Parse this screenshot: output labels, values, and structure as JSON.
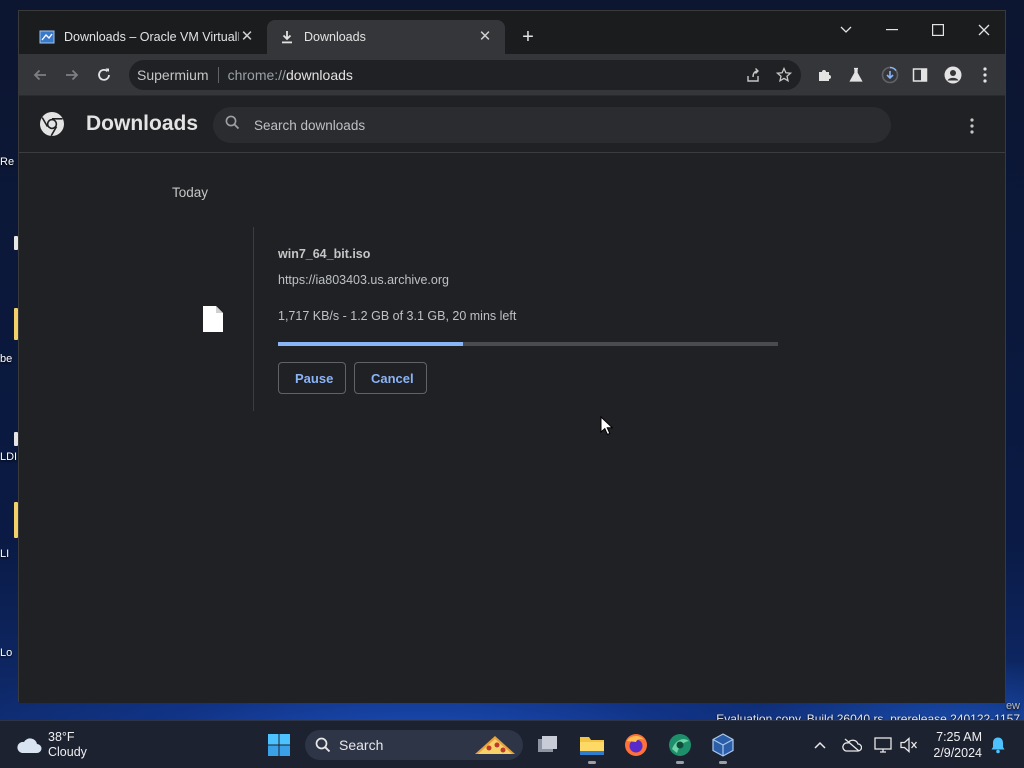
{
  "desktop": {
    "icons": [
      {
        "label": "Re"
      },
      {
        "label": "be"
      },
      {
        "label": "LDI"
      },
      {
        "label": "LI"
      },
      {
        "label": "Lo"
      }
    ]
  },
  "browser": {
    "tabs": [
      {
        "title": "Downloads – Oracle VM VirtualBox",
        "icon": "virtualbox-icon",
        "active": false
      },
      {
        "title": "Downloads",
        "icon": "download-icon",
        "active": true
      }
    ],
    "new_tab": "+",
    "address": {
      "site_name": "Supermium",
      "scheme": "chrome://",
      "path": "downloads"
    }
  },
  "downloads_page": {
    "title": "Downloads",
    "search_placeholder": "Search downloads",
    "date_group": "Today",
    "items": [
      {
        "file_name": "win7_64_bit.iso",
        "url": "https://ia803403.us.archive.org",
        "status": "1,717 KB/s - 1.2 GB of 3.1 GB, 20 mins left",
        "progress": 0.37,
        "pause_label": "Pause",
        "cancel_label": "Cancel"
      }
    ]
  },
  "watermark": {
    "line1": "ew",
    "line2": "Evaluation copy. Build 26040.rs_prerelease.240122-1157"
  },
  "taskbar": {
    "weather_temp": "38°F",
    "weather_desc": "Cloudy",
    "search_label": "Search",
    "time": "7:25 AM",
    "date": "2/9/2024"
  },
  "colors": {
    "accent": "#8ab4f8",
    "page_bg": "#202124",
    "toolbar_bg": "#35363a"
  }
}
